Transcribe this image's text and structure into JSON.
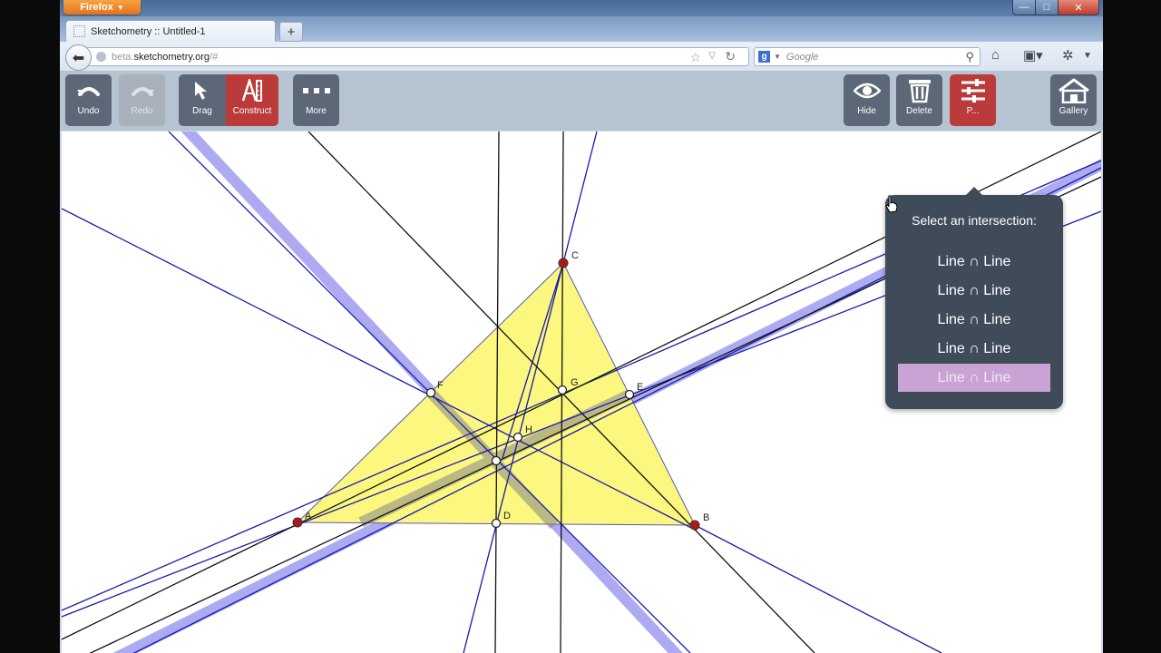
{
  "browser": {
    "app_button": "Firefox",
    "window_controls": {
      "minimize": "—",
      "maximize": "□",
      "close": "✕"
    },
    "tab": {
      "title": "Sketchometry :: Untitled-1"
    },
    "new_tab": "+",
    "url": {
      "subdomain": "beta.",
      "domain": "sketchometry.org",
      "path": "/#"
    },
    "search_placeholder": "Google",
    "icons": [
      "back-arrow-icon",
      "globe-icon",
      "bookmark-star-icon",
      "reload-icon",
      "google-icon",
      "magnifier-icon",
      "home-icon",
      "bookmarks-icon",
      "addon-icon"
    ]
  },
  "toolbar": {
    "undo": "Undo",
    "redo": "Redo",
    "drag": "Drag",
    "construct": "Construct",
    "more": "More",
    "hide": "Hide",
    "delete": "Delete",
    "properties": "P...",
    "gallery": "Gallery"
  },
  "popover": {
    "title": "Select an intersection:",
    "options": [
      "Line ∩ Line",
      "Line ∩ Line",
      "Line ∩ Line",
      "Line ∩ Line",
      "Line ∩ Line"
    ],
    "highlighted_index": 4
  },
  "geometry": {
    "points": [
      "A",
      "B",
      "C",
      "D",
      "E",
      "F",
      "G",
      "H"
    ],
    "colors": {
      "triangle_fill": "#fbf77f",
      "line_blue": "#1a1aa8",
      "line_black": "#111111",
      "highlight": "#9f9cf0",
      "vertex": "#b01818",
      "construct_active": "#bb3a3a",
      "popover_bg": "#3f4b59"
    }
  }
}
